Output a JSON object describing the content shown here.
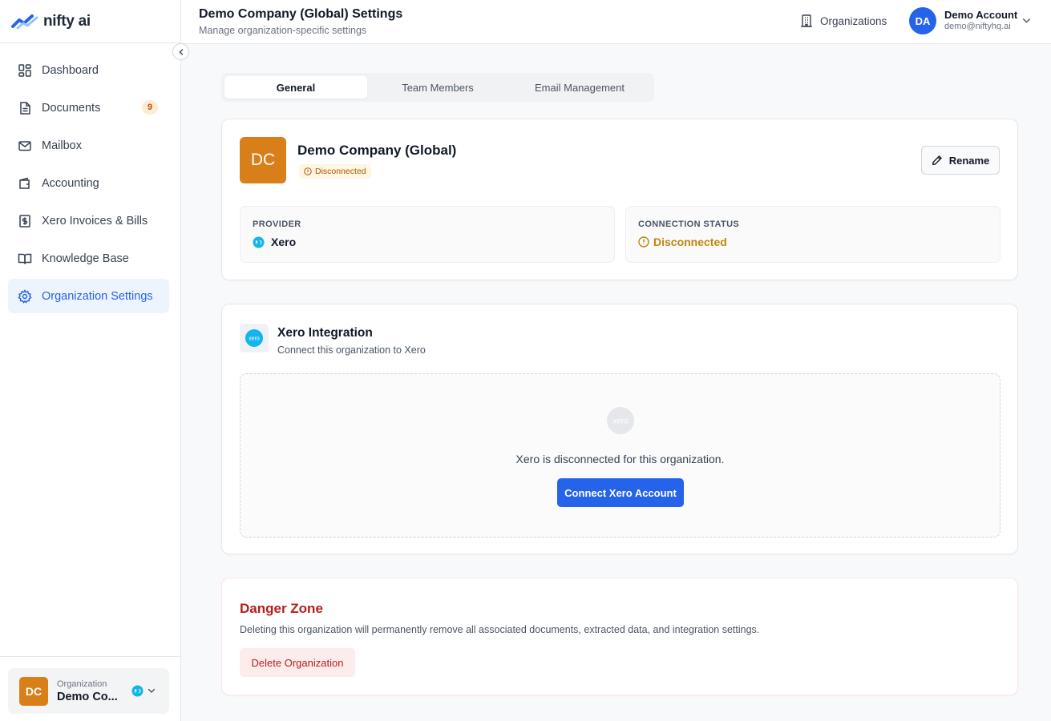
{
  "app": {
    "logo_text": "nifty ai"
  },
  "colors": {
    "accent": "#2563eb",
    "org_avatar": "#d97f1a",
    "warning": "#c2850c",
    "danger": "#b91c1c",
    "xero": "#13b5ea"
  },
  "sidebar": {
    "items": [
      {
        "label": "Dashboard",
        "icon": "dashboard-icon"
      },
      {
        "label": "Documents",
        "icon": "document-icon",
        "badge": "9"
      },
      {
        "label": "Mailbox",
        "icon": "mail-icon"
      },
      {
        "label": "Accounting",
        "icon": "wallet-icon"
      },
      {
        "label": "Xero Invoices & Bills",
        "icon": "dollar-receipt-icon"
      },
      {
        "label": "Knowledge Base",
        "icon": "book-icon"
      },
      {
        "label": "Organization Settings",
        "icon": "gear-icon",
        "active": true
      }
    ],
    "org_switcher": {
      "initials": "DC",
      "caption": "Organization",
      "name": "Demo Co..."
    }
  },
  "header": {
    "title": "Demo Company (Global) Settings",
    "subtitle": "Manage organization-specific settings",
    "organizations_label": "Organizations",
    "user": {
      "initials": "DA",
      "name": "Demo Account",
      "email": "demo@niftyhq.ai"
    }
  },
  "tabs": [
    {
      "label": "General",
      "active": true
    },
    {
      "label": "Team Members"
    },
    {
      "label": "Email Management"
    }
  ],
  "org_card": {
    "initials": "DC",
    "name": "Demo Company (Global)",
    "status": "Disconnected",
    "rename_label": "Rename",
    "provider_label": "PROVIDER",
    "provider_value": "Xero",
    "connection_label": "CONNECTION STATUS",
    "connection_value": "Disconnected"
  },
  "integration": {
    "title": "Xero Integration",
    "subtitle": "Connect this organization to Xero",
    "logo_text": "xero",
    "message": "Xero is disconnected for this organization.",
    "connect_label": "Connect Xero Account"
  },
  "danger": {
    "title": "Danger Zone",
    "description": "Deleting this organization will permanently remove all associated documents, extracted data, and integration settings.",
    "delete_label": "Delete Organization"
  }
}
